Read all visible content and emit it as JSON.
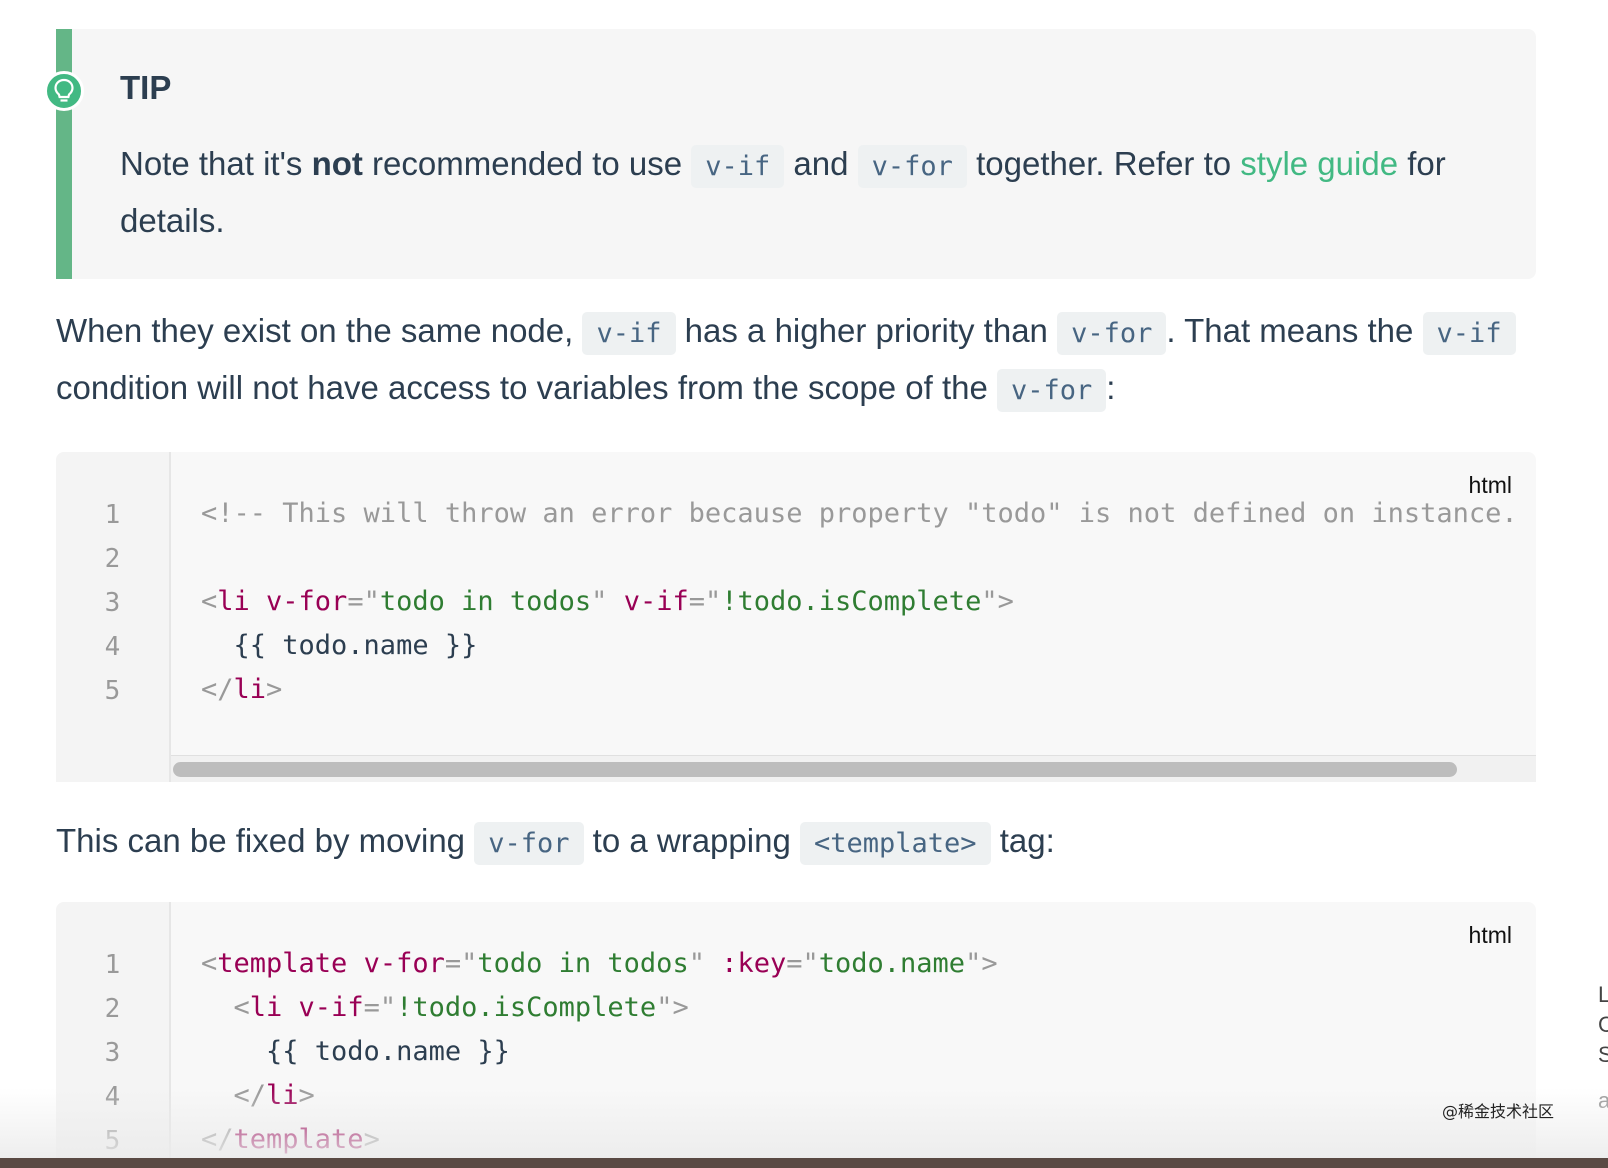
{
  "tip": {
    "icon": "lightbulb-icon",
    "title": "TIP",
    "text_1": "Note that it's ",
    "text_bold": "not",
    "text_2": " recommended to use ",
    "code_1": "v-if",
    "text_3": " and ",
    "code_2": "v-for",
    "text_4": " together. Refer to ",
    "link": "style guide",
    "text_5": " for details."
  },
  "para1": {
    "t1": "When they exist on the same node, ",
    "c1": "v-if",
    "t2": " has a higher priority than ",
    "c2": "v-for",
    "t3": ". That means the ",
    "c3": "v-if",
    "t4": " condition will not have access to variables from the scope of the ",
    "c4": "v-for",
    "t5": ":"
  },
  "code1": {
    "lang": "html",
    "line_numbers": [
      "1",
      "2",
      "3",
      "4",
      "5"
    ],
    "l1": "<!-- This will throw an error because property \"todo\" is not defined on instance.",
    "l3": {
      "open": "<",
      "tag": "li",
      "attr1": " v-for",
      "eq1": "=\"",
      "val1": "todo in todos",
      "q1": "\"",
      "attr2": " v-if",
      "eq2": "=\"",
      "val2": "!todo.isComplete",
      "close": "\">"
    },
    "l4": "  {{ todo.name }}",
    "l5": {
      "open": "</",
      "tag": "li",
      "close": ">"
    }
  },
  "para2": {
    "t1": "This can be fixed by moving ",
    "c1": "v-for",
    "t2": " to a wrapping ",
    "c2": "<template>",
    "t3": " tag:"
  },
  "code2": {
    "lang": "html",
    "line_numbers": [
      "1",
      "2",
      "3",
      "4",
      "5"
    ],
    "l1": {
      "open": "<",
      "tag": "template",
      "attr1": " v-for",
      "eq1": "=\"",
      "val1": "todo in todos",
      "q1": "\"",
      "attr2": " :key",
      "eq2": "=\"",
      "val2": "todo.name",
      "close": "\">"
    },
    "l2": {
      "indent": "  ",
      "open": "<",
      "tag": "li",
      "attr1": " v-if",
      "eq1": "=\"",
      "val1": "!todo.isComplete",
      "close": "\">"
    },
    "l3": "    {{ todo.name }}",
    "l4": {
      "indent": "  ",
      "open": "</",
      "tag": "li",
      "close": ">"
    },
    "l5": {
      "open": "</",
      "tag": "template",
      "close": ">"
    }
  },
  "side_fragments": [
    "L",
    "C",
    "S",
    "a"
  ],
  "watermark": "@稀金技术社区",
  "colors": {
    "accent_green": "#42b983",
    "tip_bar": "#64b687",
    "text": "#2c3e50",
    "inline_code": "#476582",
    "tag": "#990055",
    "string": "#2f7d32",
    "comment": "#999999"
  }
}
